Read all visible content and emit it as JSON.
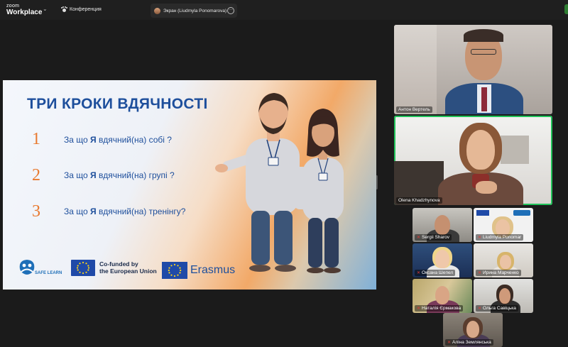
{
  "app": {
    "brand_line1": "zoom",
    "brand_line2": "Workplace",
    "meeting_label": "Конференция",
    "screen_tab_label": "Экран (Liudmyla Ponomarova)"
  },
  "slide": {
    "title": "ТРИ КРОКИ ВДЯЧНОСТІ",
    "questions": [
      {
        "num": "1",
        "pre": "За що ",
        "bold": "Я",
        "post": " вдячний(на) собі ?"
      },
      {
        "num": "2",
        "pre": "За що ",
        "bold": "Я",
        "post": " вдячний(на) групі ?"
      },
      {
        "num": "3",
        "pre": "За що ",
        "bold": "Я",
        "post": " вдячний(на) тренінгу?"
      }
    ],
    "logo_text": "SAFE LEARN",
    "eu_text_line1": "Co-funded by",
    "eu_text_line2": "the European Union",
    "erasmus": "Erasmus"
  },
  "participants": {
    "large": [
      "Антон Вертель",
      "Olena Khadzhynova"
    ],
    "small": [
      "Sergii Sharov",
      "Liudmyla Ponomar",
      "Оксана Шепел",
      "Ирина Марченко",
      "Наталія Єрмакова",
      "Ольга Савіцька",
      "Аліна Землянська"
    ]
  },
  "colors": {
    "title_blue": "#1e4f9c",
    "number_orange": "#e8792f",
    "active_speaker": "#21c35a"
  }
}
